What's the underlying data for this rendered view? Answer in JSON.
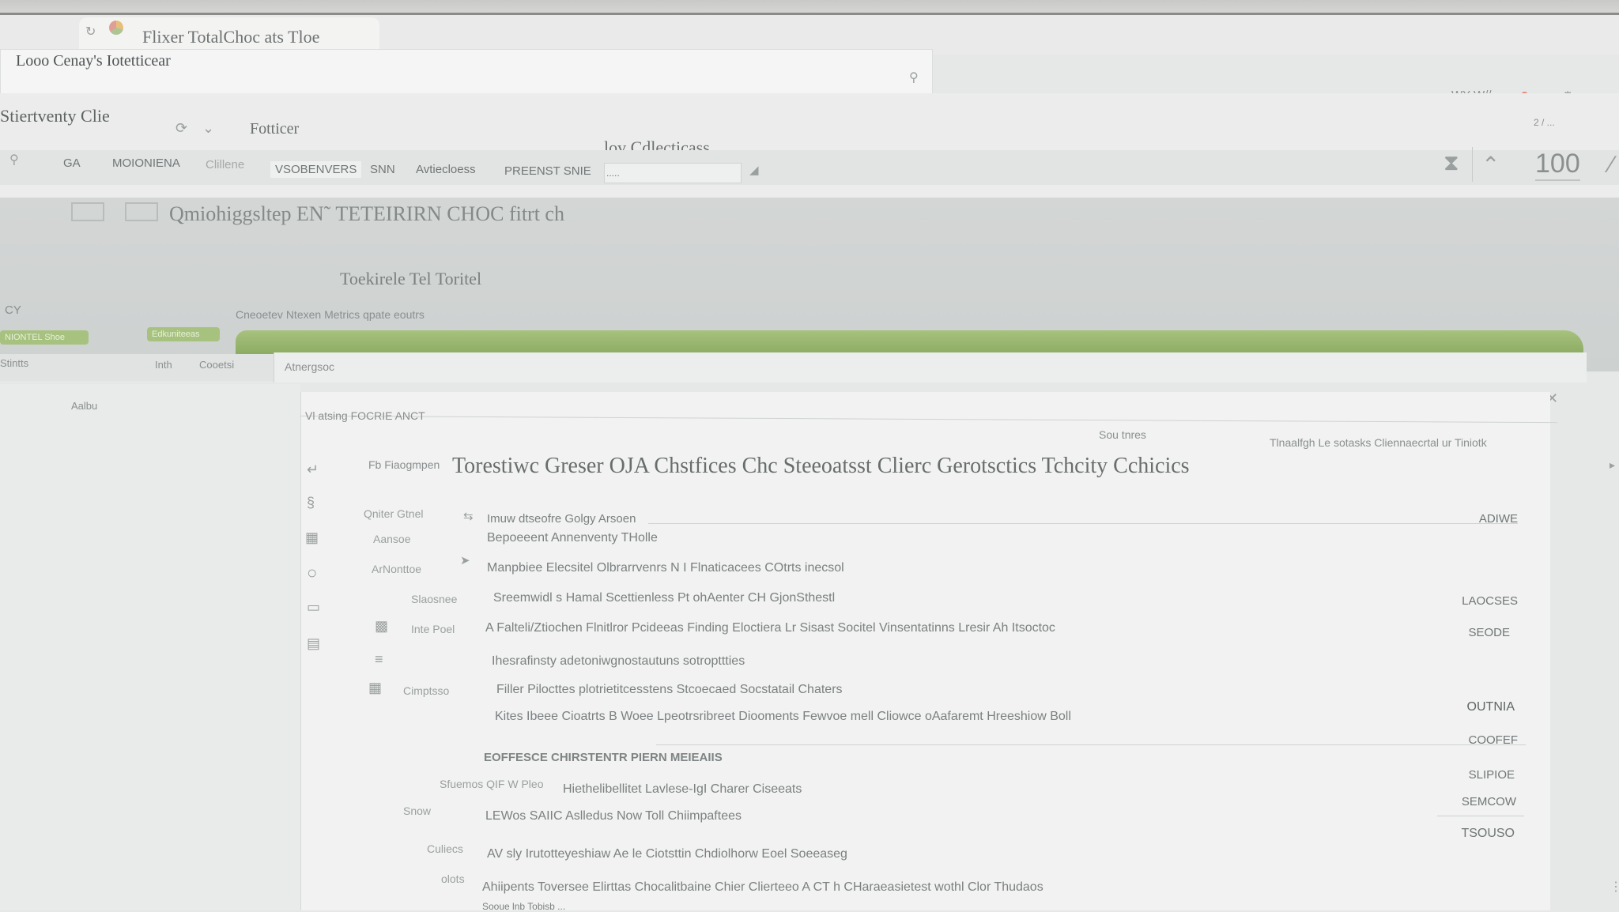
{
  "window": {
    "title": "Flixer TotalChoc ats Tloe"
  },
  "address": {
    "value": "Looo Cenay's Iotetticear"
  },
  "header": {
    "app_title": "Stiertventy Clie",
    "folder_label": "Fotticer",
    "center_title": "lov Cdlecticass",
    "zoom_value": "100",
    "right_small": "WY W//",
    "sync_text": "2 / ..."
  },
  "nav": {
    "items": [
      "GA",
      "MOIONIENA",
      "Clillene",
      "VSOBENVERS",
      "SNN",
      "Avtiecloess",
      "PREENST SNIE"
    ],
    "filter_placeholder": "....."
  },
  "band": {
    "heading": "Qmiohiggsltep EN˜ TETEIRIRN CHOC fitrt ch",
    "subheading": "Toekirele Tel Toritel",
    "caption": "Cneoetev Ntexen Metrics  qpate eoutrs",
    "side_label": "CY",
    "pill_1": "NIONTEL Shoe",
    "pill_2": "Edkuniteeas"
  },
  "tabs": {
    "left_label": "Stintts",
    "small_1": "Inth",
    "small_2": "Cooetsi",
    "active": "Atnergsoc"
  },
  "leftpane": {
    "label": "Aalbu"
  },
  "panel": {
    "section_label": "Vl atsing FOCRIE ANCT",
    "col_header": "Sou tnres",
    "right_header": "Tlnaalfgh Le sotasks  Cliennaecrtal ur Tiniotk",
    "prefix": "Fb Fiaogmpen",
    "title": "Torestiwc Greser OJA Chstfices Chc Steeoatsst Clierc Gerotsctics Tchcity Cchicics",
    "status_1": "ADIWE",
    "rows": [
      {
        "label": "Qniter Gtnel",
        "text": "Imuw dtseofre Golgy Arsoen"
      },
      {
        "label": "Aansoe",
        "text": "Bepoeeent Annenventy THolle"
      },
      {
        "label": "ArNonttoe",
        "text": "Manpbiee Elecsitel Olbrarrvenrs N I Flnaticacees COtrts inecsol"
      },
      {
        "label": "Slaosnee",
        "text": "Sreemwidl s Hamal Scettienless Pt ohAenter CH GjonSthestl",
        "status": "LAOCSES"
      },
      {
        "label": "Inte  Poel",
        "text": "A Falteli/Ztiochen Flnitlror Pcideeas Finding Eloctiera Lr Sisast Socitel Vinsentatinns Lresir Ah Itsoctoc",
        "status": "SEODE"
      },
      {
        "label": "",
        "text": "Ihesrafinsty adetoniwgnostautuns sotropttties"
      },
      {
        "label": "Cimptsso",
        "text": "Filler Pilocttes plotrietitcesstens Stcoecaed Socstatail Chaters"
      },
      {
        "label": "",
        "text": "Kites Ibeee Cioatrts B Woee Lpeotrsribreet Diooments Fewvoe mell Cliowce oAafaremt Hreeshiow Boll",
        "status": "OUTNIA"
      }
    ],
    "status_coofef": "COOFEF",
    "section_heading": "EOFFESCE CHIRSTENTR PIERN MEIEAIIS",
    "rows2": [
      {
        "label": "Sfuemos QIF W Pleo",
        "text": "Hiethelibellitet Lavlese-IgI Charer Ciseeats",
        "status": "SLIPIOE"
      },
      {
        "label": "Snow",
        "text": "LEWos SAIIC Aslledus Now Toll Chiimpaftees",
        "status": "SEMCOW"
      },
      {
        "label": "Culiecs",
        "text": "AV sly Irutotteyeshiaw Ae le Ciotsttin Chdiolhorw Eoel Soeeaseg",
        "status": "TSOUSO"
      },
      {
        "label": "olots",
        "text": "Ahiipents Toversee Elirttas Chocalitbaine Chier Clierteeo A CT h CHaraeasietest wothl Clor Thudaos"
      },
      {
        "label": "",
        "text": "Sooue lnb Tobisb ..."
      }
    ]
  }
}
